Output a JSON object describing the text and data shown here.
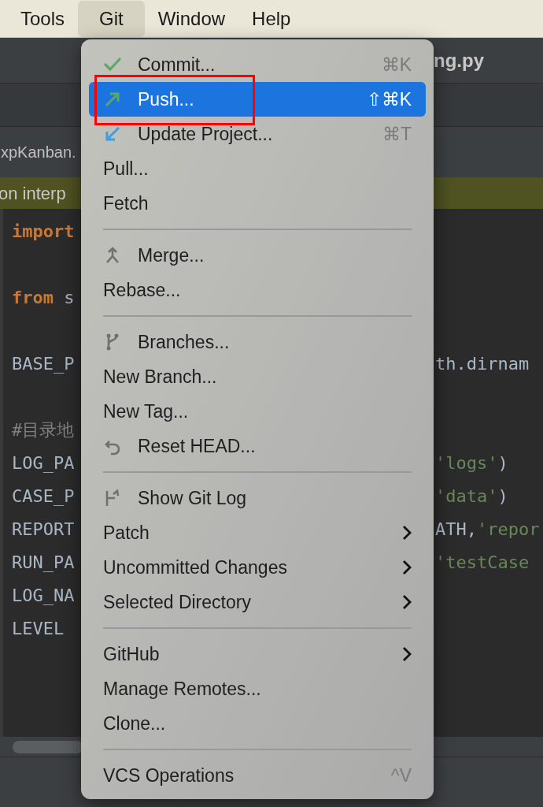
{
  "menubar": [
    {
      "label": "Tools",
      "selected": false
    },
    {
      "label": "Git",
      "selected": true
    },
    {
      "label": "Window",
      "selected": false
    },
    {
      "label": "Help",
      "selected": false
    }
  ],
  "ide": {
    "file_title": "ng.py",
    "editor_tab": "xpKanban.",
    "banner": "on interp",
    "lines": [
      {
        "kind": "code",
        "left": [
          {
            "text": "import",
            "kind": "keyword"
          }
        ]
      },
      {
        "kind": "blank"
      },
      {
        "kind": "code",
        "left": [
          {
            "text": "from",
            "kind": "keyword"
          },
          {
            "text": " s",
            "kind": "plain"
          }
        ]
      },
      {
        "kind": "blank"
      },
      {
        "kind": "code",
        "left": [
          {
            "text": "BASE_P",
            "kind": "plain"
          }
        ],
        "right": [
          {
            "text": "th.dirnam",
            "kind": "plain"
          }
        ]
      },
      {
        "kind": "blank"
      },
      {
        "kind": "code",
        "left": [
          {
            "text": "#目录地",
            "kind": "comment"
          }
        ]
      },
      {
        "kind": "code",
        "left": [
          {
            "text": "LOG_PA",
            "kind": "plain"
          }
        ],
        "right": [
          {
            "text": "'logs'",
            "kind": "string"
          },
          {
            "text": ")",
            "kind": "plain"
          }
        ]
      },
      {
        "kind": "code",
        "left": [
          {
            "text": "CASE_P",
            "kind": "plain"
          }
        ],
        "right": [
          {
            "text": "'data'",
            "kind": "string"
          },
          {
            "text": ")",
            "kind": "plain"
          }
        ]
      },
      {
        "kind": "code",
        "left": [
          {
            "text": "REPORT",
            "kind": "plain"
          }
        ],
        "right": [
          {
            "text": "ATH,",
            "kind": "plain"
          },
          {
            "text": "'repor",
            "kind": "string"
          }
        ]
      },
      {
        "kind": "code",
        "left": [
          {
            "text": "RUN_PA",
            "kind": "plain"
          }
        ],
        "right": [
          {
            "text": "'testCase",
            "kind": "string"
          }
        ]
      },
      {
        "kind": "code",
        "left": [
          {
            "text": "LOG_NA",
            "kind": "plain"
          }
        ]
      },
      {
        "kind": "code",
        "left": [
          {
            "text": "LEVEL",
            "kind": "plain"
          }
        ]
      }
    ]
  },
  "git_menu": {
    "groups": [
      [
        {
          "label": "Commit...",
          "kind": "icon",
          "shortcut": "⌘K",
          "selected": false,
          "submenu": false
        },
        {
          "label": "Push...",
          "kind": "icon",
          "shortcut": "⇧⌘K",
          "selected": true,
          "submenu": false
        },
        {
          "label": "Update Project...",
          "kind": "icon",
          "shortcut": "⌘T",
          "selected": false,
          "submenu": false
        },
        {
          "label": "Pull...",
          "selected": false,
          "submenu": false
        },
        {
          "label": "Fetch",
          "selected": false,
          "submenu": false
        }
      ],
      [
        {
          "label": "Merge...",
          "kind": "icon",
          "selected": false,
          "submenu": false
        },
        {
          "label": "Rebase...",
          "selected": false,
          "submenu": false
        }
      ],
      [
        {
          "label": "Branches...",
          "kind": "icon",
          "selected": false,
          "submenu": false
        },
        {
          "label": "New Branch...",
          "selected": false,
          "submenu": false
        },
        {
          "label": "New Tag...",
          "selected": false,
          "submenu": false
        },
        {
          "label": "Reset HEAD...",
          "kind": "icon",
          "selected": false,
          "submenu": false
        }
      ],
      [
        {
          "label": "Show Git Log",
          "kind": "icon",
          "selected": false,
          "submenu": false
        },
        {
          "label": "Patch",
          "selected": false,
          "submenu": true
        },
        {
          "label": "Uncommitted Changes",
          "selected": false,
          "submenu": true
        },
        {
          "label": "Selected Directory",
          "selected": false,
          "submenu": true
        }
      ],
      [
        {
          "label": "GitHub",
          "selected": false,
          "submenu": true
        },
        {
          "label": "Manage Remotes...",
          "selected": false,
          "submenu": false
        },
        {
          "label": "Clone...",
          "selected": false,
          "submenu": false
        }
      ],
      [
        {
          "label": "VCS Operations",
          "shortcut": "^V",
          "selected": false,
          "submenu": false
        }
      ]
    ]
  }
}
